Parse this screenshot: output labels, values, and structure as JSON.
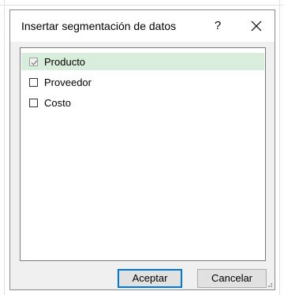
{
  "dialog": {
    "title": "Insertar segmentación de datos",
    "help_label": "?",
    "close_icon": "close-icon"
  },
  "fields": {
    "items": [
      {
        "label": "Producto",
        "checked": true,
        "selected": true,
        "enabled": false
      },
      {
        "label": "Proveedor",
        "checked": false,
        "selected": false,
        "enabled": true
      },
      {
        "label": "Costo",
        "checked": false,
        "selected": false,
        "enabled": true
      }
    ]
  },
  "buttons": {
    "accept_label": "Aceptar",
    "cancel_label": "Cancelar"
  },
  "colors": {
    "selected_row": "#d8eddc",
    "default_button_border": "#0078d7",
    "dialog_background": "#f0f0f0"
  }
}
